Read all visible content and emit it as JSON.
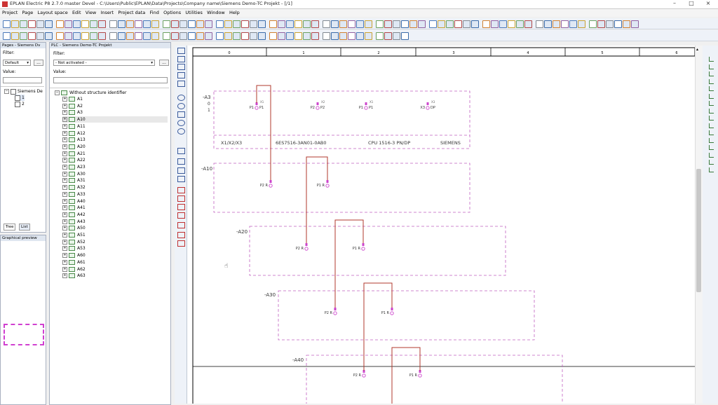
{
  "window": {
    "title": "EPLAN Electric P8 2.7.0 master Devel - C:\\Users\\Public\\EPLAN\\Data\\Projects\\Company name\\Siemens Demo-TC Projekt - [/1]"
  },
  "menu": [
    "Project",
    "Page",
    "Layout space",
    "Edit",
    "View",
    "Insert",
    "Project data",
    "Find",
    "Options",
    "Utilities",
    "Window",
    "Help"
  ],
  "pages_panel": {
    "header": "Pages - Siemens Dv",
    "filter_label": "Filter:",
    "filter_value": "Default",
    "value_label": "Value:",
    "more": "...",
    "root": "Siemens De",
    "pages": [
      "1",
      "2"
    ],
    "tabs": [
      "Tree",
      "List"
    ]
  },
  "preview_panel": {
    "header": "Graphical preview"
  },
  "plc_panel": {
    "header": "PLC - Siemens Demo-TC Projekt",
    "filter_label": "Filter:",
    "filter_value": "- Not activated -",
    "value_label": "Value:",
    "more": "...",
    "root": "Without structure identifier",
    "items": [
      "A1",
      "A2",
      "A3",
      "A10",
      "A11",
      "A12",
      "A13",
      "A20",
      "A21",
      "A22",
      "A23",
      "A30",
      "A31",
      "A32",
      "A33",
      "A40",
      "A41",
      "A42",
      "A43",
      "A50",
      "A51",
      "A52",
      "A53",
      "A60",
      "A61",
      "A62",
      "A63"
    ]
  },
  "ruler": {
    "cols": [
      "0",
      "1",
      "2",
      "3",
      "4",
      "5",
      "6"
    ]
  },
  "schematic": {
    "blocks": [
      {
        "tag": "-A3",
        "rows": [
          "0",
          "1"
        ],
        "ports": [
          {
            "left": "P1",
            "right": "P1"
          },
          {
            "left": "P2",
            "right": "P2"
          },
          {
            "left": "P1",
            "right": "P1"
          },
          {
            "left": "X3",
            "right": "DP"
          }
        ],
        "port_nums": [
          "X1",
          "X2",
          "X1",
          "X3"
        ],
        "info": [
          "X1/X2/X3",
          "6ES7516-3AN01-0AB0",
          "CPU 1516-3 PN/DP",
          "SIEMENS"
        ]
      },
      {
        "tag": "-A10",
        "ports": [
          {
            "left": "P2",
            "right": "R"
          },
          {
            "left": "P1",
            "right": "R"
          }
        ]
      },
      {
        "tag": "-A20",
        "ports": [
          {
            "left": "P2",
            "right": "R"
          },
          {
            "left": "P1",
            "right": "R"
          }
        ]
      },
      {
        "tag": "-A30",
        "ports": [
          {
            "left": "P2",
            "right": "R"
          },
          {
            "left": "P1",
            "right": "R"
          }
        ]
      },
      {
        "tag": "-A40",
        "ports": [
          {
            "left": "P2",
            "right": "R"
          },
          {
            "left": "P1",
            "right": "R"
          }
        ]
      }
    ]
  },
  "colors": {
    "accent": "#cc44cc",
    "wire": "#b03a2e",
    "dash": "#c060c0"
  }
}
